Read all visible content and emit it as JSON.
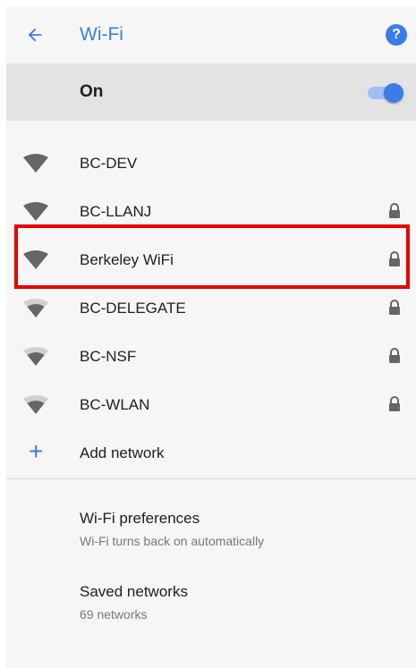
{
  "appbar": {
    "title": "Wi-Fi"
  },
  "master_switch": {
    "label": "On",
    "state": "on"
  },
  "networks": [
    {
      "name": "BC-DEV",
      "secured": false,
      "signal": "strong"
    },
    {
      "name": "BC-LLANJ",
      "secured": true,
      "signal": "strong"
    },
    {
      "name": "Berkeley WiFi",
      "secured": true,
      "signal": "strong"
    },
    {
      "name": "BC-DELEGATE",
      "secured": true,
      "signal": "medium"
    },
    {
      "name": "BC-NSF",
      "secured": true,
      "signal": "medium"
    },
    {
      "name": "BC-WLAN",
      "secured": true,
      "signal": "medium"
    }
  ],
  "add_network": {
    "icon": "plus-icon",
    "label": "Add network"
  },
  "wifi_preferences": {
    "title": "Wi-Fi preferences",
    "subtitle": "Wi-Fi turns back on automatically"
  },
  "saved_networks": {
    "title": "Saved networks",
    "subtitle": "69 networks"
  },
  "colors": {
    "accent": "#3b7de8",
    "highlight": "#e60000"
  }
}
